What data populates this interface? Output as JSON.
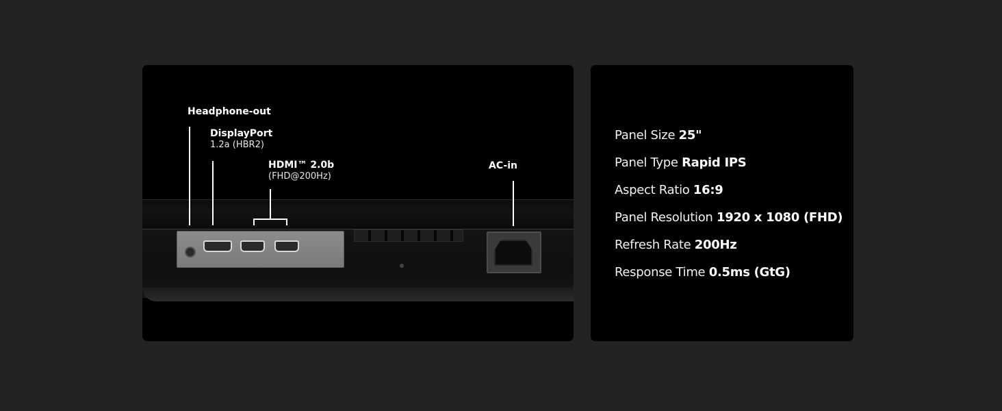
{
  "ports": {
    "headphone": {
      "title": "Headphone-out"
    },
    "displayport": {
      "title": "DisplayPort",
      "sub": "1.2a (HBR2)"
    },
    "hdmi": {
      "title": "HDMI™ 2.0b",
      "sub": "(FHD@200Hz)"
    },
    "ac": {
      "title": "AC-in"
    }
  },
  "specs": [
    {
      "label": "Panel Size",
      "value": "25\""
    },
    {
      "label": "Panel Type",
      "value": "Rapid IPS"
    },
    {
      "label": "Aspect Ratio",
      "value": "16:9"
    },
    {
      "label": "Panel Resolution",
      "value": "1920 x 1080 (FHD)"
    },
    {
      "label": "Refresh Rate",
      "value": "200Hz"
    },
    {
      "label": "Response Time",
      "value": "0.5ms (GtG)"
    }
  ],
  "colors": {
    "background": "#232323",
    "card": "#000000",
    "text": "#ffffff"
  }
}
